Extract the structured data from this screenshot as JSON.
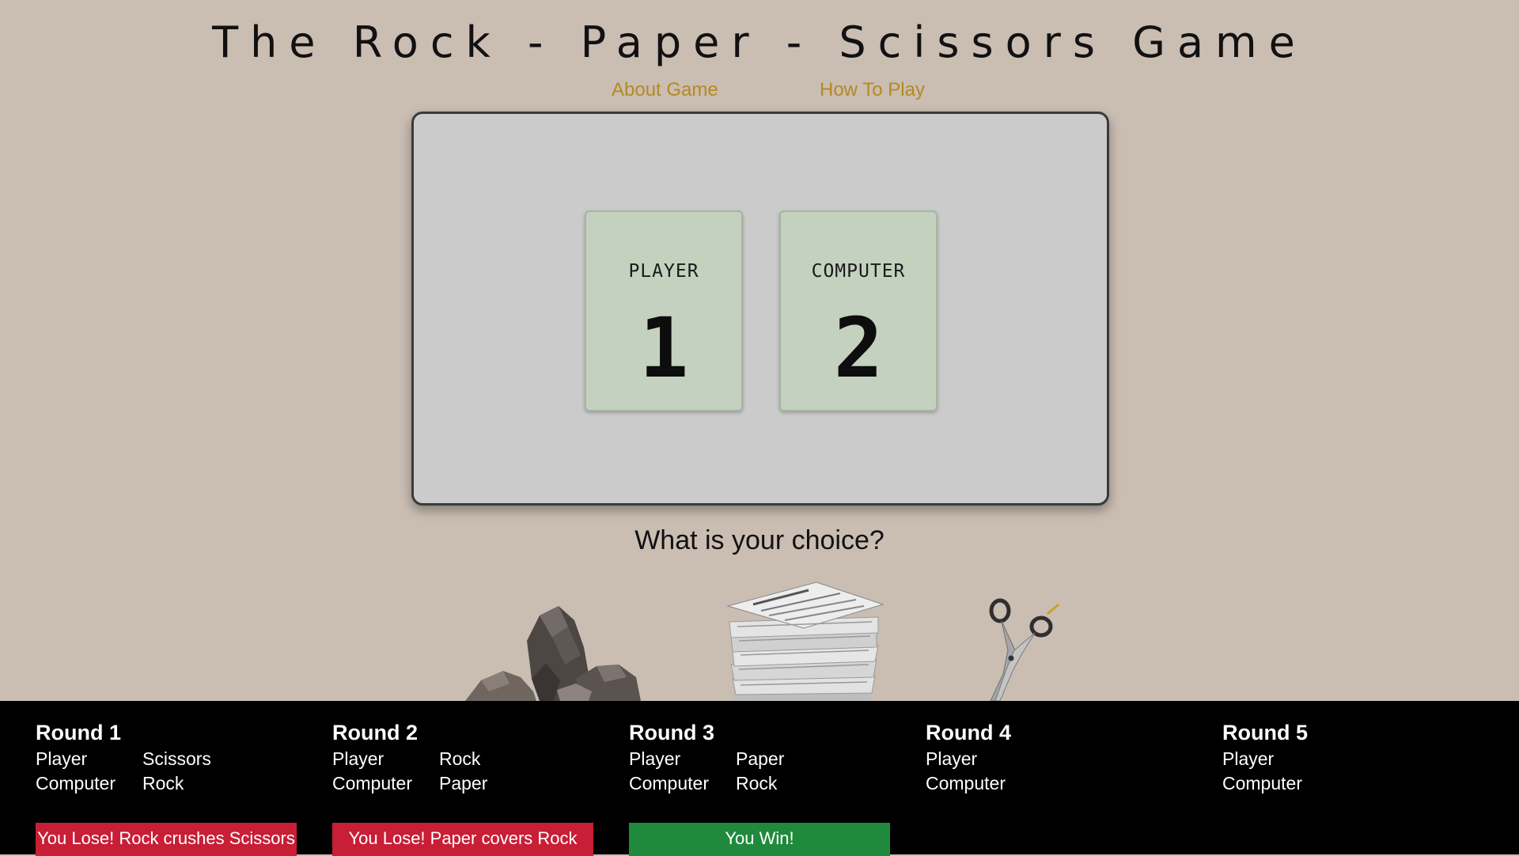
{
  "header": {
    "title": "The Rock - Paper - Scissors Game",
    "nav": {
      "about": "About Game",
      "how_to_play": "How To Play"
    }
  },
  "scoreboard": {
    "player_label": "PLAYER",
    "player_score": "1",
    "computer_label": "COMPUTER",
    "computer_score": "2"
  },
  "choices": {
    "heading": "What is your choice?",
    "options": [
      "rock",
      "paper",
      "scissors"
    ]
  },
  "history": {
    "rounds": [
      {
        "title": "Round 1",
        "player_label": "Player",
        "player_pick": "Scissors",
        "computer_label": "Computer",
        "computer_pick": "Rock",
        "result": "You Lose! Rock crushes Scissors",
        "result_status": "lose"
      },
      {
        "title": "Round 2",
        "player_label": "Player",
        "player_pick": "Rock",
        "computer_label": "Computer",
        "computer_pick": "Paper",
        "result": "You Lose! Paper covers Rock",
        "result_status": "lose"
      },
      {
        "title": "Round 3",
        "player_label": "Player",
        "player_pick": "Paper",
        "computer_label": "Computer",
        "computer_pick": "Rock",
        "result": "You Win!",
        "result_status": "win"
      },
      {
        "title": "Round 4",
        "player_label": "Player",
        "player_pick": "",
        "computer_label": "Computer",
        "computer_pick": "",
        "result": "",
        "result_status": "none"
      },
      {
        "title": "Round 5",
        "player_label": "Player",
        "player_pick": "",
        "computer_label": "Computer",
        "computer_pick": "",
        "result": "",
        "result_status": "none"
      }
    ]
  },
  "colors": {
    "background": "#cabdb2",
    "nav_link": "#b38a22",
    "lose": "#c81e36",
    "win": "#1f8a3b"
  }
}
